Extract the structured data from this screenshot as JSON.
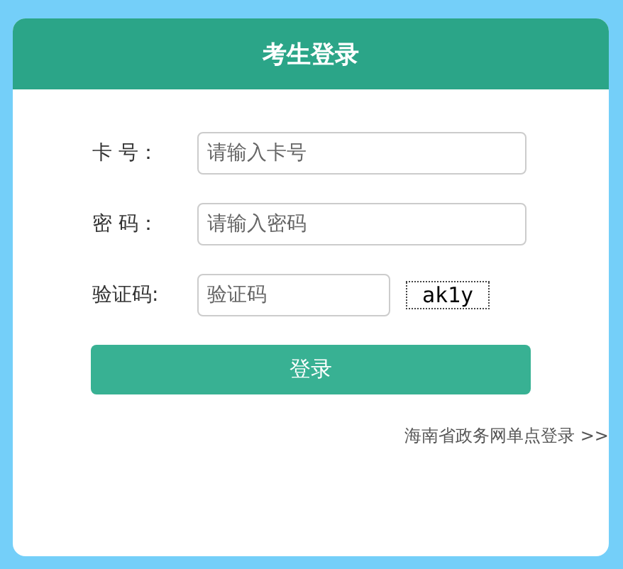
{
  "title": "考生登录",
  "fields": [
    {
      "label": "卡 号：",
      "placeholder": "请输入卡号",
      "kind": "text"
    },
    {
      "label": "密 码：",
      "placeholder": "请输入密码",
      "kind": "password"
    },
    {
      "label": "验证码:",
      "placeholder": "验证码",
      "kind": "captcha",
      "captcha": "ak1y"
    }
  ],
  "button": "登录",
  "link": "海南省政务网单点登录 >>"
}
